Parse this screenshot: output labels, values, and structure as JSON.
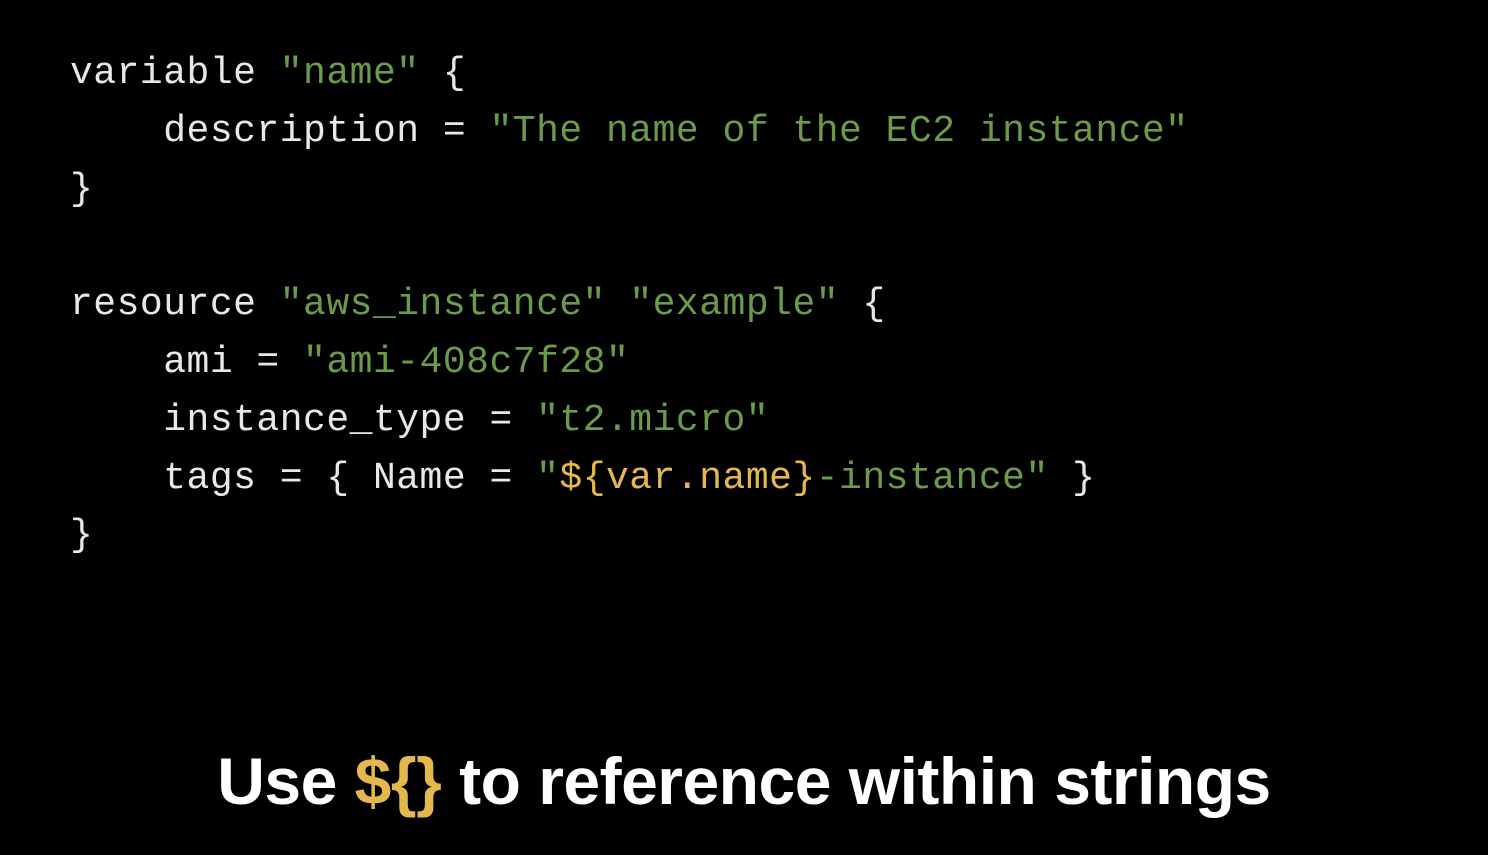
{
  "code": {
    "l1_kw": "variable ",
    "l1_str": "\"name\"",
    "l1_rest": " {",
    "l2_indent": "    ",
    "l2_attr": "description = ",
    "l2_str": "\"The name of the EC2 instance\"",
    "l3": "}",
    "l4_kw": "resource ",
    "l4_str1": "\"aws_instance\"",
    "l4_sp": " ",
    "l4_str2": "\"example\"",
    "l4_rest": " {",
    "l5_indent": "    ",
    "l5_attr": "ami = ",
    "l5_str": "\"ami-408c7f28\"",
    "l6_indent": "    ",
    "l6_attr": "instance_type = ",
    "l6_str": "\"t2.micro\"",
    "l7_indent": "    ",
    "l7_attr": "tags = { Name = ",
    "l7_q1": "\"",
    "l7_interp": "${var.name}",
    "l7_suffix": "-instance\"",
    "l7_rest": " }",
    "l8": "}"
  },
  "caption": {
    "pre": "Use ",
    "highlight": "${}",
    "post": " to reference within strings"
  }
}
